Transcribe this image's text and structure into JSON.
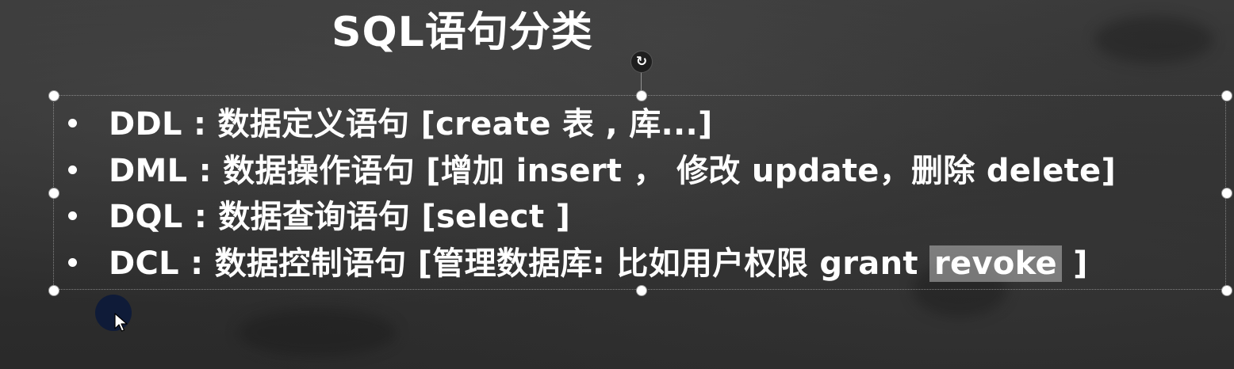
{
  "slide": {
    "title": "SQL语句分类",
    "items": [
      {
        "text": "DDL : 数据定义语句  [create 表 , 库...]"
      },
      {
        "text": "DML : 数据操作语句 [增加 insert ， 修改 update，删除 delete]"
      },
      {
        "text": "DQL : 数据查询语句 [select ]"
      },
      {
        "text_before": "DCL : 数据控制语句 [管理数据库: 比如用户权限 grant ",
        "highlighted": "revoke",
        "text_after": " ]"
      }
    ]
  },
  "selection": {
    "rotate_icon": "rotate-icon"
  },
  "cursor": {
    "icon": "mouse-pointer-icon",
    "highlight_color": "#0c1a3a"
  }
}
